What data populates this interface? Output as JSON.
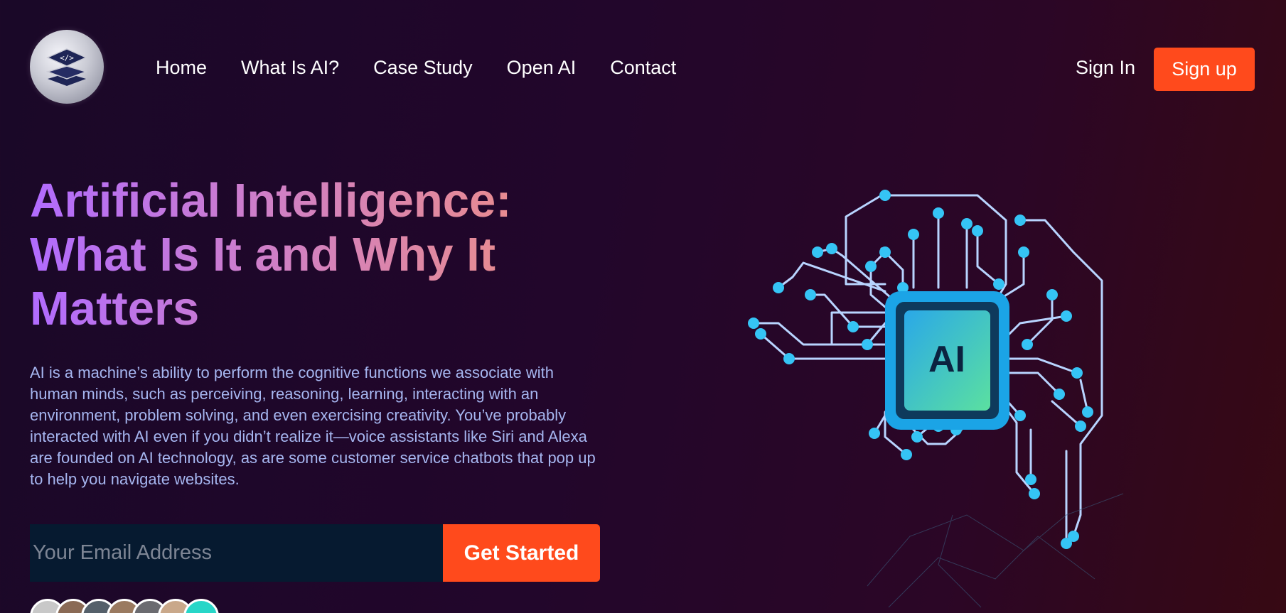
{
  "logo": {
    "icon": "stacked-layers-code-icon"
  },
  "nav": {
    "items": [
      "Home",
      "What Is AI?",
      "Case Study",
      "Open AI",
      "Contact"
    ]
  },
  "auth": {
    "sign_in": "Sign In",
    "sign_up": "Sign up"
  },
  "hero": {
    "title": "Artificial Intelligence: What Is It and Why It Matters",
    "description": "AI is a machine’s ability to perform the cognitive functions we associate with human minds, such as perceiving, reasoning, learning, interacting with an environment, problem solving, and even exercising creativity. You’ve probably interacted with AI even if you didn’t realize it—voice assistants like Siri and Alexa are founded on AI technology, as are some customer service chatbots that pop up to help you navigate websites.",
    "email_placeholder": "Your Email Address",
    "cta": "Get Started"
  },
  "illustration": {
    "chip_label": "AI"
  },
  "colors": {
    "accent": "#ff4a1c",
    "circuit": "#35c4f5",
    "title_start": "#b16bff",
    "title_end": "#ee8f83"
  }
}
